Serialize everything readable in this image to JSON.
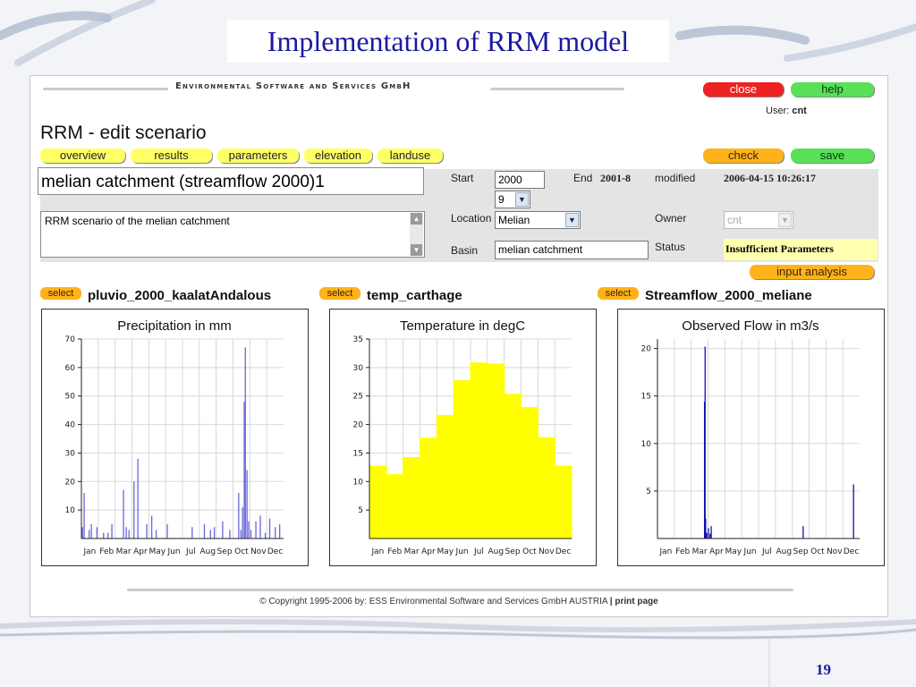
{
  "slide": {
    "title": "Implementation of RRM model",
    "page_number": "19"
  },
  "header": {
    "company": "Environmental Software and Services GmbH"
  },
  "top_buttons": {
    "close": "close",
    "help": "help"
  },
  "user": {
    "label": "User:",
    "name": "cnt"
  },
  "page_title": "RRM - edit scenario",
  "tabs": [
    "overview",
    "results",
    "parameters",
    "elevation",
    "landuse"
  ],
  "action_buttons": {
    "check": "check",
    "save": "save"
  },
  "scenario": {
    "name": "melian catchment (streamflow 2000)1",
    "description": "RRM scenario of the melian catchment",
    "start_label": "Start",
    "start_year": "2000",
    "start_month": "9",
    "end_label": "End",
    "end_value": "2001-8",
    "modified_label": "modified",
    "modified_value": "2006-04-15 10:26:17",
    "location_label": "Location",
    "location_value": "Melian",
    "owner_label": "Owner",
    "owner_value": "cnt",
    "basin_label": "Basin",
    "basin_value": "melian catchment",
    "status_label": "Status",
    "status_value": "Insufficient Parameters"
  },
  "input_analysis": "input analysis",
  "select_label": "select",
  "series_titles": [
    "pluvio_2000_kaalatAndalous",
    "temp_carthage",
    "Streamflow_2000_meliane"
  ],
  "chart_data": [
    {
      "type": "bar",
      "title": "Precipitation in mm",
      "ylim": [
        0,
        70
      ],
      "yticks": [
        10,
        20,
        30,
        40,
        50,
        60,
        70
      ],
      "xticks": [
        "Jan",
        "Feb",
        "Mar",
        "Apr",
        "May",
        "Jun",
        "Jul",
        "Aug",
        "Sep",
        "Oct",
        "Nov",
        "Dec"
      ],
      "color": "#6666dd",
      "x": [
        2,
        5,
        14,
        18,
        28,
        40,
        48,
        55,
        76,
        81,
        86,
        95,
        102,
        118,
        127,
        135,
        155,
        200,
        222,
        233,
        240,
        255,
        268,
        284,
        288,
        291,
        294,
        296,
        299,
        302,
        306,
        315,
        323,
        332,
        340,
        350,
        358
      ],
      "values": [
        4,
        16,
        3,
        5,
        4,
        2,
        2,
        5,
        17,
        4,
        3,
        20,
        28,
        5,
        8,
        3,
        5,
        4,
        5,
        3,
        4,
        6,
        3,
        16,
        3,
        11,
        48,
        67,
        24,
        6,
        3,
        6,
        8,
        2,
        7,
        4,
        5
      ]
    },
    {
      "type": "bar",
      "title": "Temperature in degC",
      "ylim": [
        0,
        35
      ],
      "yticks": [
        5,
        10,
        15,
        20,
        25,
        30,
        35
      ],
      "xticks": [
        "Jan",
        "Feb",
        "Mar",
        "Apr",
        "May",
        "Jun",
        "Jul",
        "Aug",
        "Sep",
        "Oct",
        "Nov",
        "Dec"
      ],
      "color": "#ffff00",
      "steps": [
        12.7,
        11.2,
        14.2,
        17.6,
        21.6,
        27.7,
        30.8,
        30.6,
        25.3,
        23.0,
        17.7,
        12.7
      ]
    },
    {
      "type": "bar",
      "title": "Observed Flow in m3/s",
      "ylim": [
        0,
        21
      ],
      "yticks": [
        5,
        10,
        15,
        20
      ],
      "xticks": [
        "Jan",
        "Feb",
        "Mar",
        "Apr",
        "May",
        "Jun",
        "Jul",
        "Aug",
        "Sep",
        "Oct",
        "Nov",
        "Dec"
      ],
      "color": "#1111aa",
      "x": [
        85,
        86,
        87,
        89,
        92,
        95,
        97,
        263,
        354
      ],
      "values": [
        14.4,
        20.2,
        2.1,
        0.6,
        1.1,
        0.5,
        1.3,
        1.3,
        5.7
      ]
    }
  ],
  "footer": {
    "copyright": "© Copyright 1995-2006 by:  ESS  Environmental Software and Services GmbH AUSTRIA",
    "separator": "|",
    "print": "print page"
  }
}
